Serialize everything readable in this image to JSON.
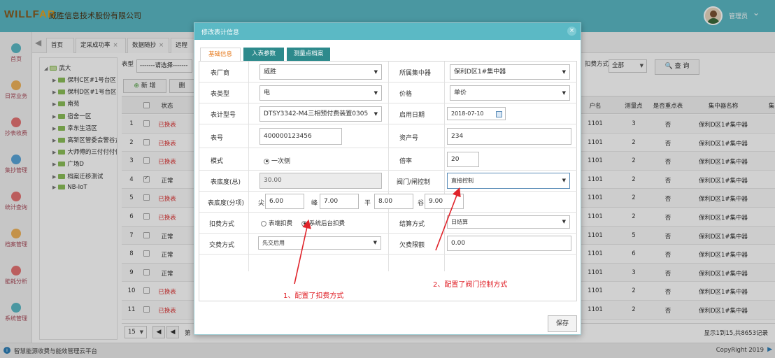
{
  "header": {
    "logo_a": "WILLF",
    "logo_b": "AR",
    "company": "威胜信息技术股份有限公司",
    "user": "管理员"
  },
  "sidebar": [
    {
      "label": "首页",
      "color": "#5bb9c5"
    },
    {
      "label": "日常业务",
      "color": "#f0b35a"
    },
    {
      "label": "抄表收费",
      "color": "#e57373"
    },
    {
      "label": "集抄管理",
      "color": "#5aa5d8"
    },
    {
      "label": "统计查询",
      "color": "#e57373"
    },
    {
      "label": "档案管理",
      "color": "#f0b35a"
    },
    {
      "label": "能耗分析",
      "color": "#e57373"
    },
    {
      "label": "系统管理",
      "color": "#5bb9c5"
    }
  ],
  "page_tabs": [
    {
      "label": "首页",
      "closable": false
    },
    {
      "label": "定采成功率",
      "closable": true
    },
    {
      "label": "数据随抄",
      "closable": true
    },
    {
      "label": "远程",
      "closable": false
    }
  ],
  "tree": {
    "root": "武大",
    "nodes": [
      "保利C区#1号台区",
      "保利D区#1号台区",
      "南苑",
      "宿舍一区",
      "幸东生活区",
      "高新区管委会警谷企",
      "大师傅的三付付付付",
      "广场D",
      "档案迁移测试",
      "NB-IoT"
    ]
  },
  "filters": {
    "type_label": "表型",
    "type_value": "-------请选择-------",
    "pay_label": "扣费方式",
    "pay_value": "全部",
    "query_label": "查 询",
    "add_label": "新 增",
    "edit_label": "删"
  },
  "grid": {
    "headers_left": [
      "状态"
    ],
    "headers_right": [
      "户名",
      "测量点",
      "是否重点表",
      "集中器名称",
      "集"
    ],
    "rows": [
      {
        "n": "1",
        "status": "已换表",
        "red": true,
        "checked": false,
        "name": "1101",
        "point": "3",
        "key": "否",
        "conc": "保利D区1#集中器"
      },
      {
        "n": "2",
        "status": "已换表",
        "red": true,
        "checked": false,
        "name": "1101",
        "point": "2",
        "key": "否",
        "conc": "保利D区1#集中器"
      },
      {
        "n": "3",
        "status": "已换表",
        "red": true,
        "checked": false,
        "name": "1101",
        "point": "2",
        "key": "否",
        "conc": "保利D区1#集中器"
      },
      {
        "n": "4",
        "status": "正常",
        "red": false,
        "checked": true,
        "name": "1101",
        "point": "2",
        "key": "否",
        "conc": "保利D区1#集中器"
      },
      {
        "n": "5",
        "status": "已换表",
        "red": true,
        "checked": false,
        "name": "1101",
        "point": "2",
        "key": "否",
        "conc": "保利D区1#集中器"
      },
      {
        "n": "6",
        "status": "已换表",
        "red": true,
        "checked": false,
        "name": "1101",
        "point": "2",
        "key": "否",
        "conc": "保利D区1#集中器"
      },
      {
        "n": "7",
        "status": "正常",
        "red": false,
        "checked": false,
        "name": "1101",
        "point": "5",
        "key": "否",
        "conc": "保利D区1#集中器"
      },
      {
        "n": "8",
        "status": "正常",
        "red": false,
        "checked": false,
        "name": "1101",
        "point": "6",
        "key": "否",
        "conc": "保利D区1#集中器"
      },
      {
        "n": "9",
        "status": "正常",
        "red": false,
        "checked": false,
        "name": "1101",
        "point": "3",
        "key": "否",
        "conc": "保利D区1#集中器"
      },
      {
        "n": "10",
        "status": "已换表",
        "red": true,
        "checked": false,
        "name": "1101",
        "point": "2",
        "key": "否",
        "conc": "保利D区1#集中器"
      },
      {
        "n": "11",
        "status": "已换表",
        "red": true,
        "checked": false,
        "name": "1101",
        "point": "2",
        "key": "否",
        "conc": "保利D区1#集中器"
      }
    ],
    "page_size": "15",
    "page_text": "第",
    "summary": "显示1到15,共8653记录"
  },
  "footer": {
    "platform": "智慧能源收费与能效管理云平台",
    "copyright": "CopyRight 2019"
  },
  "modal": {
    "title": "修改表计信息",
    "tabs": [
      "基础信息",
      "入表参数",
      "测量点档案"
    ],
    "fields": {
      "manufacturer_label": "表厂商",
      "manufacturer": "威胜",
      "concentrator_label": "所属集中器",
      "concentrator": "保利D区1#集中器",
      "meter_type_label": "表类型",
      "meter_type": "电",
      "price_label": "价格",
      "price": "单价",
      "model_label": "表计型号",
      "model": "DTSY3342-M4三相预付费装置0305",
      "enable_date_label": "启用日期",
      "enable_date": "2018-07-10",
      "meter_no_label": "表号",
      "meter_no": "400000123456",
      "asset_no_label": "资产号",
      "asset_no": "234",
      "mode_label": "模式",
      "mode_option": "一次侧",
      "ratio_label": "倍率",
      "ratio": "20",
      "base_total_label": "表底度(总)",
      "base_total": "30.00",
      "valve_label": "阀门/闸控制",
      "valve": "直接控制",
      "base_split_label": "表底度(分项)",
      "tip_label": "尖",
      "tip": "6.00",
      "peak_label": "峰",
      "peak": "7.00",
      "flat_label": "平",
      "flat": "8.00",
      "valley_label": "谷",
      "valley": "9.00",
      "deduct_label": "扣费方式",
      "deduct_opt1": "表端扣费",
      "deduct_opt2": "系统后台扣费",
      "settle_label": "结算方式",
      "settle": "日结算",
      "pay_label": "交费方式",
      "pay": "先交后用",
      "arrears_label": "欠费限额",
      "arrears": "0.00"
    },
    "save_label": "保存"
  },
  "annotations": {
    "note1": "1、配置了扣费方式",
    "note2": "2、配置了阀门控制方式",
    "color": "#e0232a"
  }
}
